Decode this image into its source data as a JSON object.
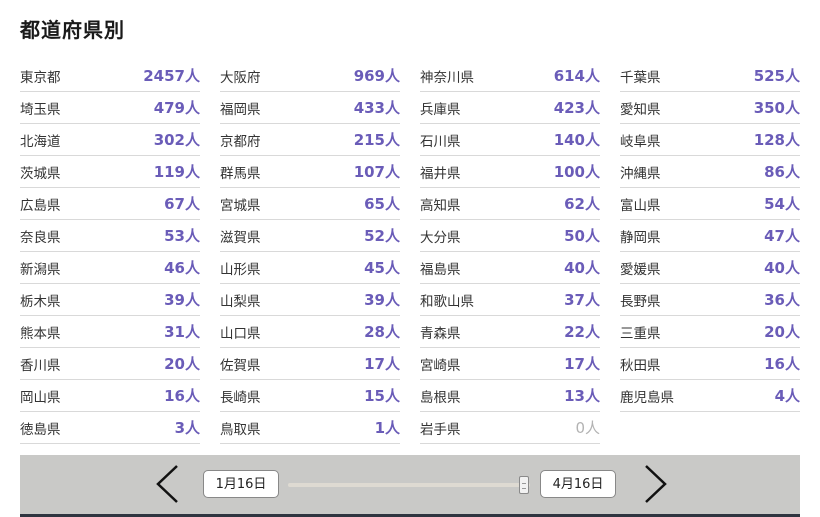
{
  "title": "都道府県別",
  "columns": [
    [
      {
        "name": "東京都",
        "count": "2457人"
      },
      {
        "name": "埼玉県",
        "count": "479人"
      },
      {
        "name": "北海道",
        "count": "302人"
      },
      {
        "name": "茨城県",
        "count": "119人"
      },
      {
        "name": "広島県",
        "count": "67人"
      },
      {
        "name": "奈良県",
        "count": "53人"
      },
      {
        "name": "新潟県",
        "count": "46人"
      },
      {
        "name": "栃木県",
        "count": "39人"
      },
      {
        "name": "熊本県",
        "count": "31人"
      },
      {
        "name": "香川県",
        "count": "20人"
      },
      {
        "name": "岡山県",
        "count": "16人"
      },
      {
        "name": "徳島県",
        "count": "3人"
      }
    ],
    [
      {
        "name": "大阪府",
        "count": "969人"
      },
      {
        "name": "福岡県",
        "count": "433人"
      },
      {
        "name": "京都府",
        "count": "215人"
      },
      {
        "name": "群馬県",
        "count": "107人"
      },
      {
        "name": "宮城県",
        "count": "65人"
      },
      {
        "name": "滋賀県",
        "count": "52人"
      },
      {
        "name": "山形県",
        "count": "45人"
      },
      {
        "name": "山梨県",
        "count": "39人"
      },
      {
        "name": "山口県",
        "count": "28人"
      },
      {
        "name": "佐賀県",
        "count": "17人"
      },
      {
        "name": "長崎県",
        "count": "15人"
      },
      {
        "name": "鳥取県",
        "count": "1人"
      }
    ],
    [
      {
        "name": "神奈川県",
        "count": "614人"
      },
      {
        "name": "兵庫県",
        "count": "423人"
      },
      {
        "name": "石川県",
        "count": "140人"
      },
      {
        "name": "福井県",
        "count": "100人"
      },
      {
        "name": "高知県",
        "count": "62人"
      },
      {
        "name": "大分県",
        "count": "50人"
      },
      {
        "name": "福島県",
        "count": "40人"
      },
      {
        "name": "和歌山県",
        "count": "37人"
      },
      {
        "name": "青森県",
        "count": "22人"
      },
      {
        "name": "宮崎県",
        "count": "17人"
      },
      {
        "name": "島根県",
        "count": "13人"
      },
      {
        "name": "岩手県",
        "count": "0人"
      }
    ],
    [
      {
        "name": "千葉県",
        "count": "525人"
      },
      {
        "name": "愛知県",
        "count": "350人"
      },
      {
        "name": "岐阜県",
        "count": "128人"
      },
      {
        "name": "沖縄県",
        "count": "86人"
      },
      {
        "name": "富山県",
        "count": "54人"
      },
      {
        "name": "静岡県",
        "count": "47人"
      },
      {
        "name": "愛媛県",
        "count": "40人"
      },
      {
        "name": "長野県",
        "count": "36人"
      },
      {
        "name": "三重県",
        "count": "20人"
      },
      {
        "name": "秋田県",
        "count": "16人"
      },
      {
        "name": "鹿児島県",
        "count": "4人"
      }
    ]
  ],
  "slider": {
    "start_label": "1月16日",
    "end_label": "4月16日",
    "prev_icon": "chevron-left-icon",
    "next_icon": "chevron-right-icon"
  },
  "colors": {
    "count": "#6a5cb8",
    "zero_count": "#b3b3b3",
    "slider_bar": "#c9c9c7"
  }
}
